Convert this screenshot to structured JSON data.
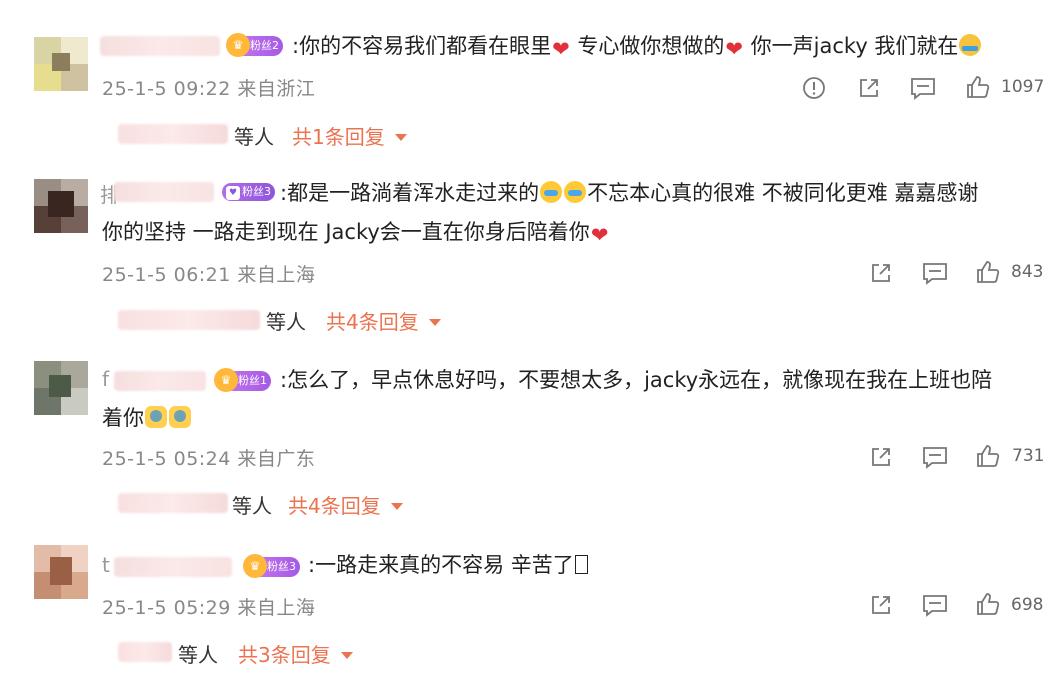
{
  "comments": [
    {
      "badge": "粉丝2",
      "text_parts": [
        "你的不容易我们都看在眼里",
        "专心做你想做的",
        "你一声jacky 我们就在"
      ],
      "line2": "",
      "time": "25-1-5 09:22 来自浙江",
      "likes": "1097",
      "replies_prefix": "等人",
      "replies_link": "共1条回复",
      "name_initial": ""
    },
    {
      "badge": "粉丝3",
      "text_parts": [
        ":都是一路淌着浑水走过来的",
        "不忘本心真的很难 不被同化更难 嘉嘉感谢"
      ],
      "line2": "你的坚持 一路走到现在 Jacky会一直在你身后陪着你",
      "time": "25-1-5 06:21 来自上海",
      "likes": "843",
      "replies_prefix": "等人",
      "replies_link": "共4条回复",
      "name_initial": "排"
    },
    {
      "badge": "粉丝1",
      "text_parts": [
        ":怎么了，早点休息好吗，不要想太多，jacky永远在，就像现在我在上班也陪"
      ],
      "line2": "着你",
      "time": "25-1-5 05:24 来自广东",
      "likes": "731",
      "replies_prefix": "等人",
      "replies_link": "共4条回复",
      "name_initial": "f"
    },
    {
      "badge": "粉丝3",
      "text_parts": [
        ":一路走来真的不容易 辛苦了"
      ],
      "line2": "",
      "time": "25-1-5 05:29 来自上海",
      "likes": "698",
      "replies_prefix": "等人",
      "replies_link": "共3条回复",
      "name_initial": "t"
    }
  ],
  "icons": {
    "report": "report-icon",
    "share": "share-icon",
    "comment": "comment-icon",
    "like": "thumbs-up-icon",
    "expand": "caret-down-icon"
  },
  "colors": {
    "accent": "#eb7350",
    "badge": "#a45ae4",
    "heart": "#e0303b",
    "meta": "#888888"
  }
}
